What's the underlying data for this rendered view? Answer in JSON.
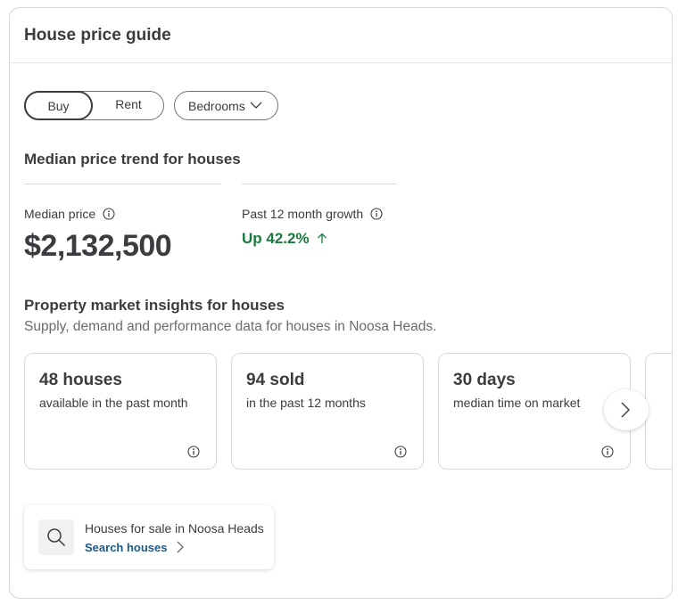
{
  "card": {
    "title": "House price guide"
  },
  "filters": {
    "buy_label": "Buy",
    "rent_label": "Rent",
    "selected": "Buy",
    "bedrooms_label": "Bedrooms"
  },
  "trend": {
    "title": "Median price trend for houses",
    "median_label": "Median price",
    "median_value": "$2,132,500",
    "growth_label": "Past 12 month growth",
    "growth_value": "Up 42.2%",
    "growth_color": "#1a7a3f"
  },
  "insights": {
    "title": "Property market insights for houses",
    "subtitle": "Supply, demand and performance data for houses in Noosa Heads.",
    "tiles": [
      {
        "value": "48 houses",
        "description": "available in the past month",
        "icon": "info-icon"
      },
      {
        "value": "94 sold",
        "description": "in the past 12 months",
        "icon": "info-icon"
      },
      {
        "value": "30 days",
        "description": "median time on market",
        "icon": "info-icon"
      }
    ],
    "next_icon": "chevron-right-icon"
  },
  "search": {
    "title": "Houses for sale in Noosa Heads",
    "link_label": "Search houses",
    "icon": "search-icon",
    "link_color": "#1c5a8a"
  }
}
